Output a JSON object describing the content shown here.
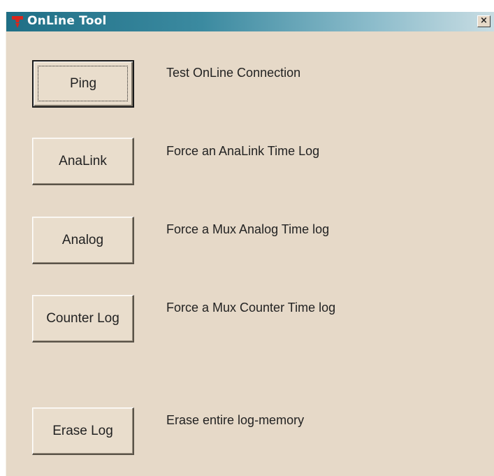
{
  "window": {
    "title": "OnLine Tool",
    "close_label": "×"
  },
  "actions": [
    {
      "button_label": "Ping",
      "description": "Test OnLine Connection"
    },
    {
      "button_label": "AnaLink",
      "description": "Force an AnaLink Time Log"
    },
    {
      "button_label": "Analog",
      "description": "Force a Mux Analog Time log"
    },
    {
      "button_label": "Counter Log",
      "description": "Force a Mux Counter Time log"
    },
    {
      "button_label": "Erase Log",
      "description": "Erase entire log-memory"
    }
  ],
  "colors": {
    "title_gradient_start": "#1f6f86",
    "title_gradient_end": "#c9dde3",
    "dialog_background": "#e6d9c8",
    "app_icon": "#d9261c"
  },
  "icons": {
    "app_icon": "red-funnel-icon",
    "close_icon": "close-icon"
  }
}
